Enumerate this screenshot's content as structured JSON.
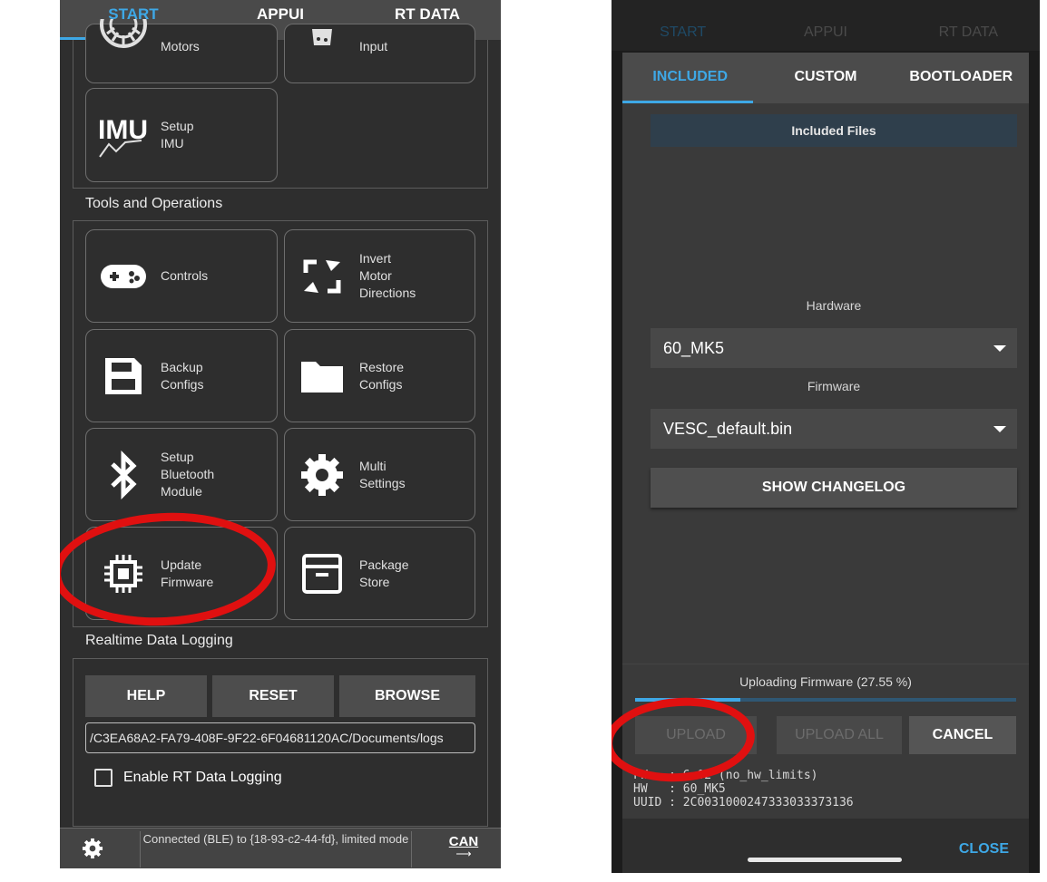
{
  "left": {
    "tabs": [
      {
        "label": "START",
        "active": true
      },
      {
        "label": "APPUI",
        "active": false
      },
      {
        "label": "RT DATA",
        "active": false
      }
    ],
    "top_tiles": [
      {
        "label": "Motors"
      },
      {
        "label": "Input"
      },
      {
        "label": "Setup\nIMU"
      }
    ],
    "imu_icon_text": "IMU",
    "tools_title": "Tools and Operations",
    "tools_tiles": [
      {
        "label": "Controls",
        "icon": "gamepad-icon"
      },
      {
        "label": "Invert\nMotor\nDirections",
        "icon": "invert-arrows-icon"
      },
      {
        "label": "Backup\nConfigs",
        "icon": "save-icon"
      },
      {
        "label": "Restore\nConfigs",
        "icon": "folder-icon"
      },
      {
        "label": "Setup\nBluetooth\nModule",
        "icon": "bluetooth-icon"
      },
      {
        "label": "Multi\nSettings",
        "icon": "gear-icon"
      },
      {
        "label": "Update\nFirmware",
        "icon": "chip-icon"
      },
      {
        "label": "Package\nStore",
        "icon": "box-icon"
      }
    ],
    "logging_title": "Realtime Data Logging",
    "logging_buttons": {
      "help": "HELP",
      "reset": "RESET",
      "browse": "BROWSE"
    },
    "log_path": "/C3EA68A2-FA79-408F-9F22-6F04681120AC/Documents/logs",
    "enable_logging_label": "Enable RT Data Logging",
    "enable_logging_checked": false,
    "status_text": "Connected (BLE) to {18-93-c2-44-fd}, limited mode",
    "can_label": "CAN",
    "accent_color": "#3ea8e6",
    "highlight_color": "#e01010"
  },
  "right": {
    "background_tabs": [
      {
        "label": "START",
        "active": true
      },
      {
        "label": "APPUI",
        "active": false
      },
      {
        "label": "RT DATA",
        "active": false
      }
    ],
    "dialog_tabs": [
      {
        "label": "INCLUDED",
        "active": true
      },
      {
        "label": "CUSTOM",
        "active": false
      },
      {
        "label": "BOOTLOADER",
        "active": false
      }
    ],
    "files_header": "Included Files",
    "hardware_label": "Hardware",
    "hardware_value": "60_MK5",
    "firmware_label": "Firmware",
    "firmware_value": "VESC_default.bin",
    "changelog_button": "SHOW CHANGELOG",
    "progress_text": "Uploading Firmware (27.55 %)",
    "progress_fraction": 0.2755,
    "buttons": {
      "upload": "UPLOAD",
      "upload_all": "UPLOAD ALL",
      "cancel": "CANCEL"
    },
    "info_lines": {
      "fw": "FW   : 6.02 (no_hw_limits)",
      "hw": "HW   : 60_MK5",
      "uuid": "UUID : 2C0031000247333033373136"
    },
    "close_button": "CLOSE"
  }
}
